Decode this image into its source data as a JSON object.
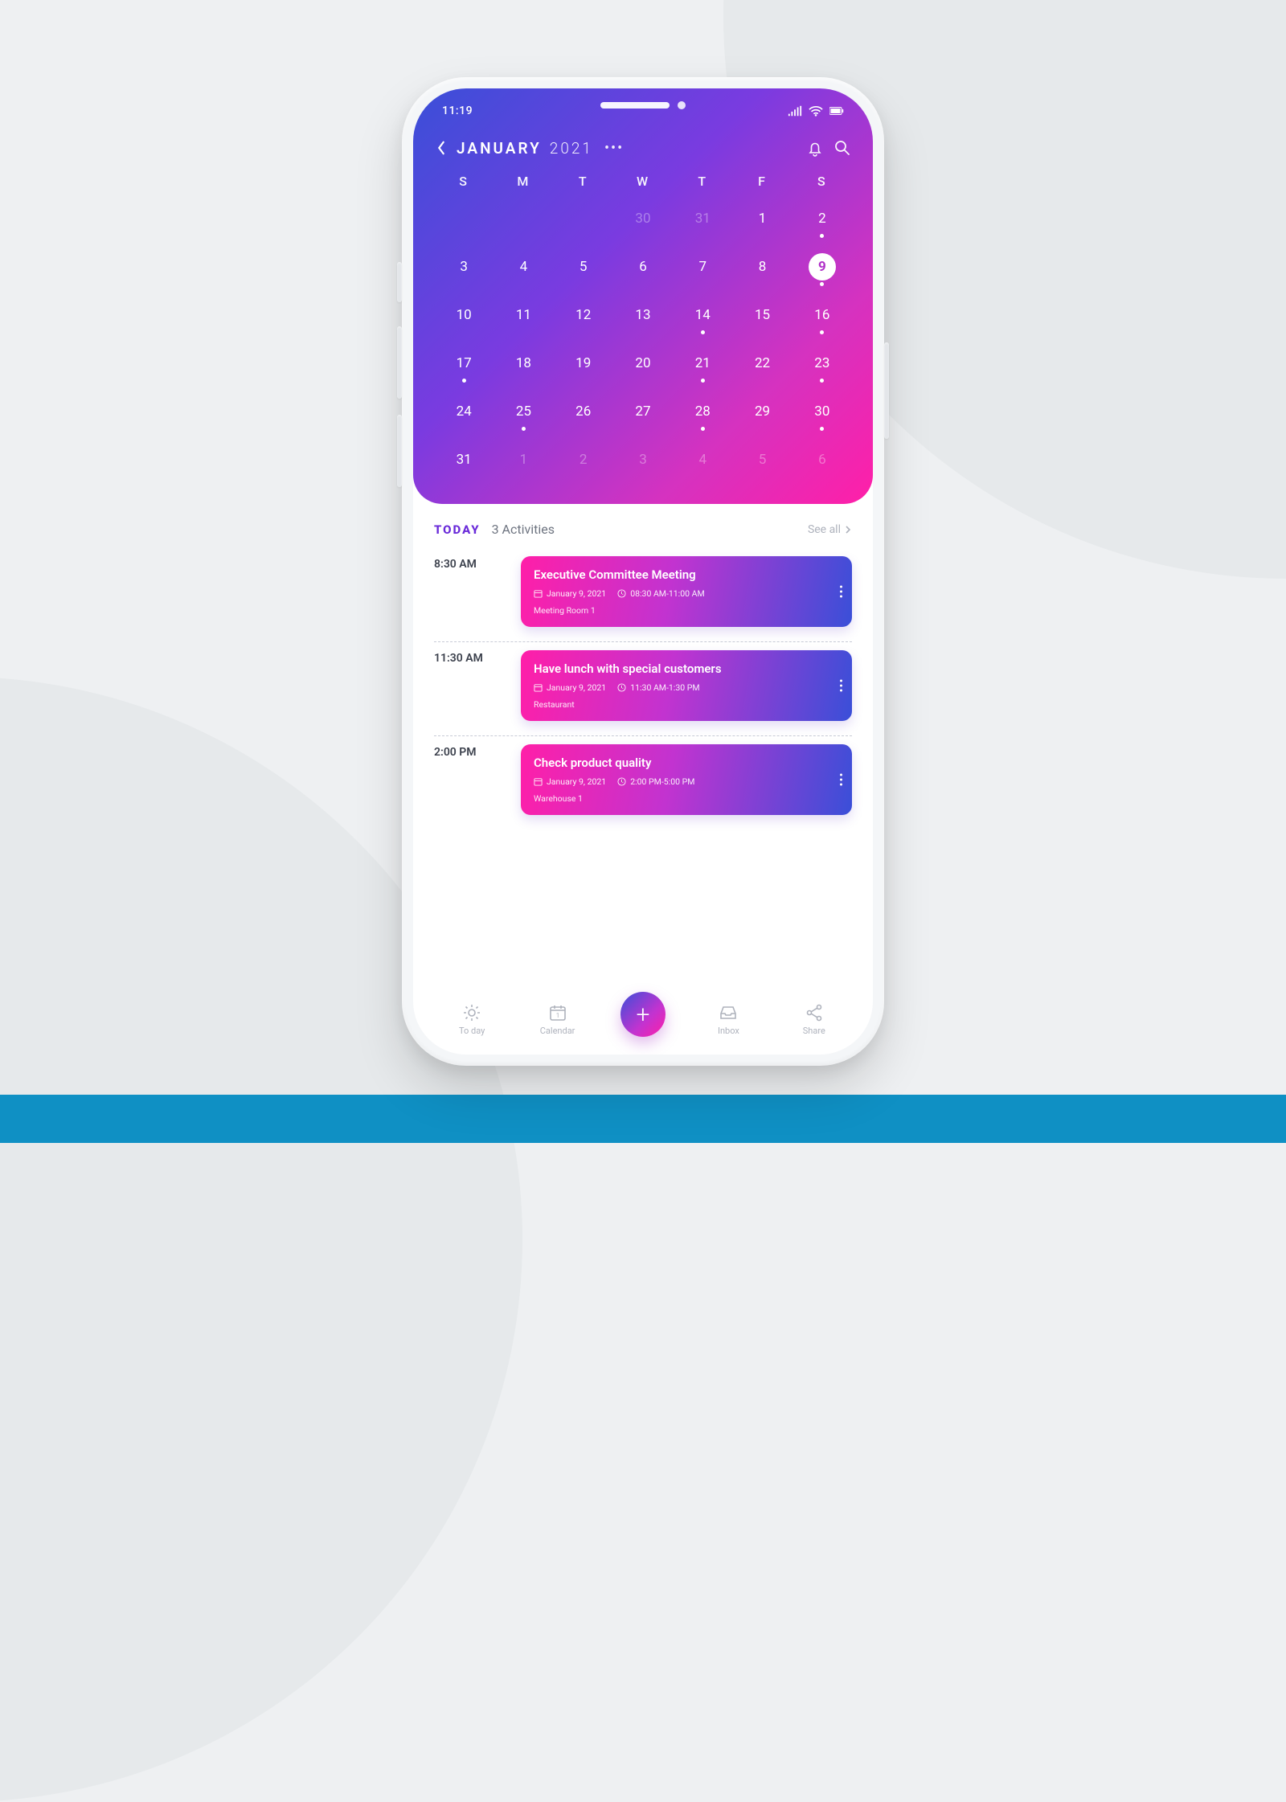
{
  "status": {
    "time": "11:19"
  },
  "header": {
    "month": "JANUARY",
    "year": "2021",
    "more": "•••"
  },
  "calendar": {
    "dow": [
      "S",
      "M",
      "T",
      "W",
      "T",
      "F",
      "S"
    ],
    "weeks": [
      [
        {
          "n": "",
          "dim": true,
          "dot": false
        },
        {
          "n": "",
          "dim": true,
          "dot": false
        },
        {
          "n": "",
          "dim": true,
          "dot": false
        },
        {
          "n": "30",
          "dim": true,
          "dot": false
        },
        {
          "n": "31",
          "dim": true,
          "dot": false
        },
        {
          "n": "1",
          "dot": false
        },
        {
          "n": "2",
          "dot": true
        }
      ],
      [
        {
          "n": "3",
          "dot": false
        },
        {
          "n": "4",
          "dot": false
        },
        {
          "n": "5",
          "dot": false
        },
        {
          "n": "6",
          "dot": false
        },
        {
          "n": "7",
          "dot": false
        },
        {
          "n": "8",
          "dot": false
        },
        {
          "n": "9",
          "dot": true,
          "selected": true
        }
      ],
      [
        {
          "n": "10",
          "dot": false
        },
        {
          "n": "11",
          "dot": false
        },
        {
          "n": "12",
          "dot": false
        },
        {
          "n": "13",
          "dot": false
        },
        {
          "n": "14",
          "dot": true
        },
        {
          "n": "15",
          "dot": false
        },
        {
          "n": "16",
          "dot": true
        }
      ],
      [
        {
          "n": "17",
          "dot": true
        },
        {
          "n": "18",
          "dot": false
        },
        {
          "n": "19",
          "dot": false
        },
        {
          "n": "20",
          "dot": false
        },
        {
          "n": "21",
          "dot": true
        },
        {
          "n": "22",
          "dot": false
        },
        {
          "n": "23",
          "dot": true
        }
      ],
      [
        {
          "n": "24",
          "dot": false
        },
        {
          "n": "25",
          "dot": true
        },
        {
          "n": "26",
          "dot": false
        },
        {
          "n": "27",
          "dot": false
        },
        {
          "n": "28",
          "dot": true
        },
        {
          "n": "29",
          "dot": false
        },
        {
          "n": "30",
          "dot": true
        }
      ],
      [
        {
          "n": "31",
          "dot": false
        },
        {
          "n": "1",
          "dim": true,
          "dot": false
        },
        {
          "n": "2",
          "dim": true,
          "dot": false
        },
        {
          "n": "3",
          "dim": true,
          "dot": false
        },
        {
          "n": "4",
          "dim": true,
          "dot": false
        },
        {
          "n": "5",
          "dim": true,
          "dot": false
        },
        {
          "n": "6",
          "dim": true,
          "dot": false
        }
      ]
    ]
  },
  "activities": {
    "today_label": "TODAY",
    "count_label": "3 Activities",
    "see_all": "See all",
    "items": [
      {
        "time": "8:30 AM",
        "title": "Executive Committee Meeting",
        "date": "January 9, 2021",
        "range": "08:30 AM-11:00 AM",
        "location": "Meeting Room 1"
      },
      {
        "time": "11:30 AM",
        "title": "Have lunch with special customers",
        "date": "January 9, 2021",
        "range": "11:30 AM-1:30 PM",
        "location": "Restaurant"
      },
      {
        "time": "2:00 PM",
        "title": "Check product quality",
        "date": "January 9, 2021",
        "range": "2:00 PM-5:00 PM",
        "location": "Warehouse 1"
      }
    ]
  },
  "nav": {
    "today": "To day",
    "calendar": "Calendar",
    "add": "+",
    "inbox": "Inbox",
    "share": "Share"
  }
}
